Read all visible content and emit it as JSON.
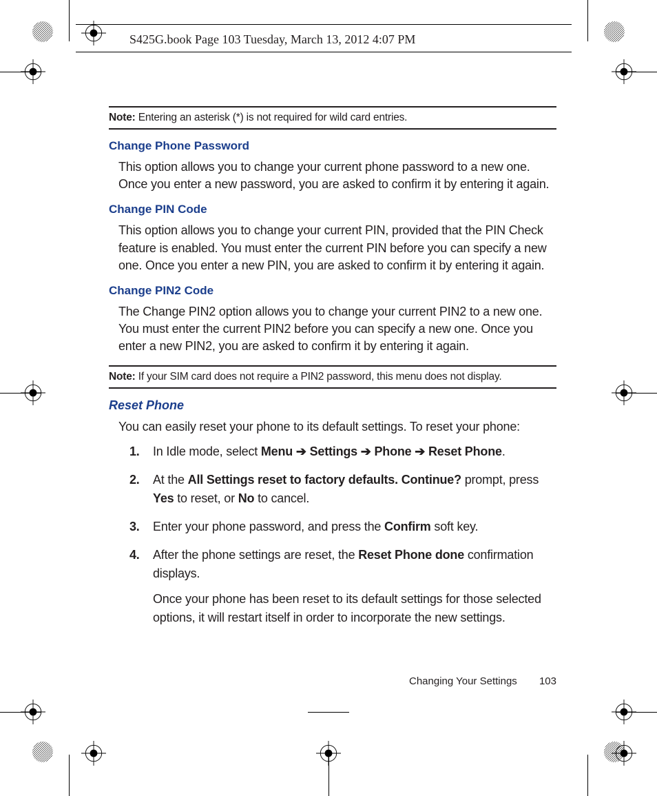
{
  "header": {
    "text": "S425G.book  Page 103  Tuesday, March 13, 2012  4:07 PM"
  },
  "note1": {
    "label": "Note:",
    "text": " Entering an asterisk (*) is not required for wild card entries."
  },
  "h1": "Change Phone Password",
  "p1": "This option allows you to change your current phone password to a new one. Once you enter a new password, you are asked to confirm it by entering it again.",
  "h2": "Change PIN Code",
  "p2": "This option allows you to change your current PIN, provided that the PIN Check feature is enabled. You must enter the current PIN before you can specify a new one. Once you enter a new PIN, you are asked to confirm it by entering it again.",
  "h3": "Change PIN2 Code",
  "p3": "The Change PIN2 option allows you to change your current PIN2 to a new one. You must enter the current PIN2 before you can specify a new one. Once you enter a new PIN2, you are asked to confirm it by entering it again.",
  "note2": {
    "label": "Note:",
    "text": "  If your SIM card does not require a PIN2 password, this menu does not display."
  },
  "h4": "Reset Phone",
  "p4": "You can easily reset your phone to its default settings. To reset your phone:",
  "steps": {
    "s1": {
      "num": "1.",
      "a": "In Idle mode, select ",
      "menu": "Menu",
      "arr": " ➔ ",
      "settings": "Settings",
      "phone": "Phone",
      "reset": "Reset Phone",
      "dot": "."
    },
    "s2": {
      "num": "2.",
      "a": "At the ",
      "prompt": "All Settings reset to factory defaults. Continue?",
      "b": " prompt, press ",
      "yes": "Yes",
      "c": " to reset, or ",
      "no": "No",
      "d": " to cancel."
    },
    "s3": {
      "num": "3.",
      "a": "Enter your phone password, and press the ",
      "confirm": "Confirm",
      "b": " soft key."
    },
    "s4": {
      "num": "4.",
      "a": "After the phone settings are reset, the ",
      "done": "Reset Phone done",
      "b": " confirmation displays.",
      "follow": "Once your phone has been reset to its default settings for those selected options, it will restart itself in order to incorporate the new settings."
    }
  },
  "footer": {
    "section": "Changing Your Settings",
    "page": "103"
  }
}
